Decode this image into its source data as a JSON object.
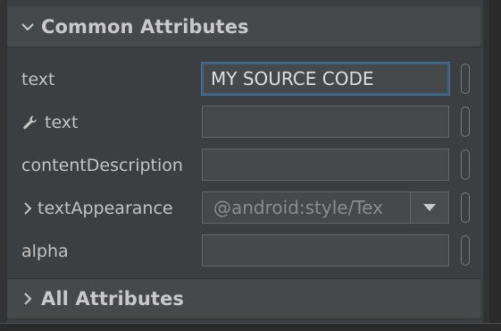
{
  "common_section": {
    "title": "Common Attributes",
    "icon": "chevron-down-icon"
  },
  "attributes": [
    {
      "label": "text",
      "value": "MY SOURCE CODE",
      "focused": true
    },
    {
      "label": "text",
      "value": "",
      "icon": "wrench-icon"
    },
    {
      "label": "contentDescription",
      "value": ""
    },
    {
      "label": "textAppearance",
      "value": "@android:style/Tex",
      "expandable": true
    },
    {
      "label": "alpha",
      "value": ""
    }
  ],
  "all_section": {
    "title": "All Attributes",
    "icon": "chevron-right-icon"
  },
  "colors": {
    "panel_background": "#3c3f41",
    "header_background": "#45494a",
    "focus_border": "#3d6185",
    "text": "#bbbbbb"
  }
}
